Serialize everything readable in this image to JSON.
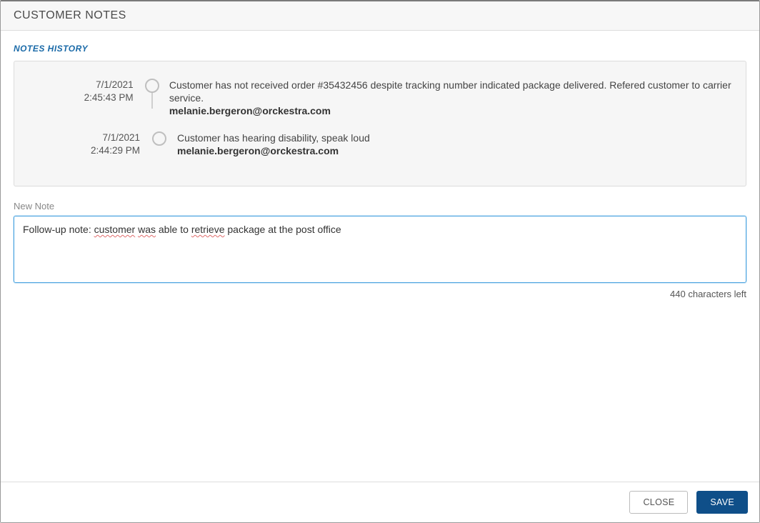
{
  "header": {
    "title": "CUSTOMER NOTES"
  },
  "history": {
    "section_label": "NOTES HISTORY",
    "items": [
      {
        "date": "7/1/2021",
        "time": "2:45:43 PM",
        "text": "Customer has not received order #35432456 despite tracking number indicated package delivered. Refered customer to carrier service.",
        "author": "melanie.bergeron@orckestra.com"
      },
      {
        "date": "7/1/2021",
        "time": "2:44:29 PM",
        "text": "Customer has hearing disability, speak loud",
        "author": "melanie.bergeron@orckestra.com"
      }
    ]
  },
  "new_note": {
    "label": "New Note",
    "value_prefix": "Follow-up note: ",
    "value_w1": "customer",
    "value_sp1": " ",
    "value_w2": "was",
    "value_mid": " able to ",
    "value_w3": "retrieve",
    "value_suffix": " package at the post office",
    "chars_left": "440 characters left"
  },
  "footer": {
    "close_label": "CLOSE",
    "save_label": "SAVE"
  }
}
